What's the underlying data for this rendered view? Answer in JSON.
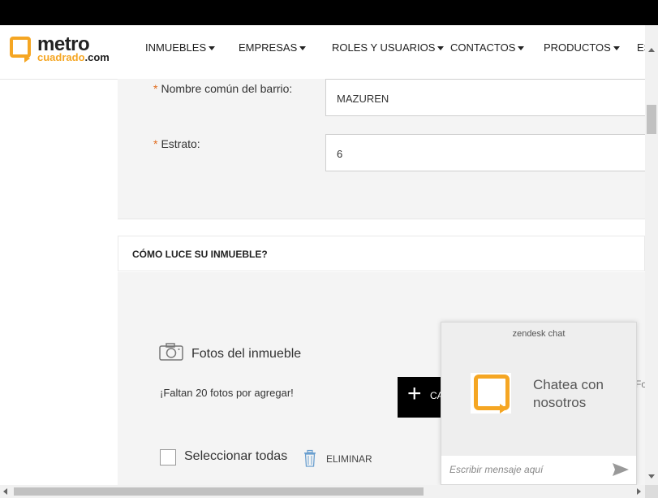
{
  "header": {
    "logo_line1": "metro",
    "logo_line2_a": "cuadrado",
    "logo_line2_b": ".com",
    "nav": [
      "INMUEBLES",
      "EMPRESAS",
      "ROLES Y USUARIOS",
      "CONTACTOS",
      "PRODUCTOS",
      "ES"
    ]
  },
  "form": {
    "barrio_label": "Nombre común del barrio:",
    "barrio_value": "MAZUREN",
    "estrato_label": "Estrato:",
    "estrato_value": "6",
    "required_mark": "*"
  },
  "photos": {
    "section_title": "CÓMO LUCE SU INMUEBLE?",
    "title": "Fotos del inmueble",
    "remaining": "¡Faltan 20 fotos por agregar!",
    "add_button_partial": "CA",
    "select_all": "Seleccionar todas",
    "delete": "ELIMINAR",
    "partial_right": "Fo"
  },
  "chat": {
    "brand": "zendesk chat",
    "title": "Chatea con nosotros",
    "input_placeholder": "Escribir mensaje aquí"
  },
  "colors": {
    "brand_orange": "#f5a623",
    "required_orange": "#e06a1b"
  },
  "icons": [
    "camera-icon",
    "plus-icon",
    "trash-icon",
    "send-icon",
    "logo-icon"
  ]
}
